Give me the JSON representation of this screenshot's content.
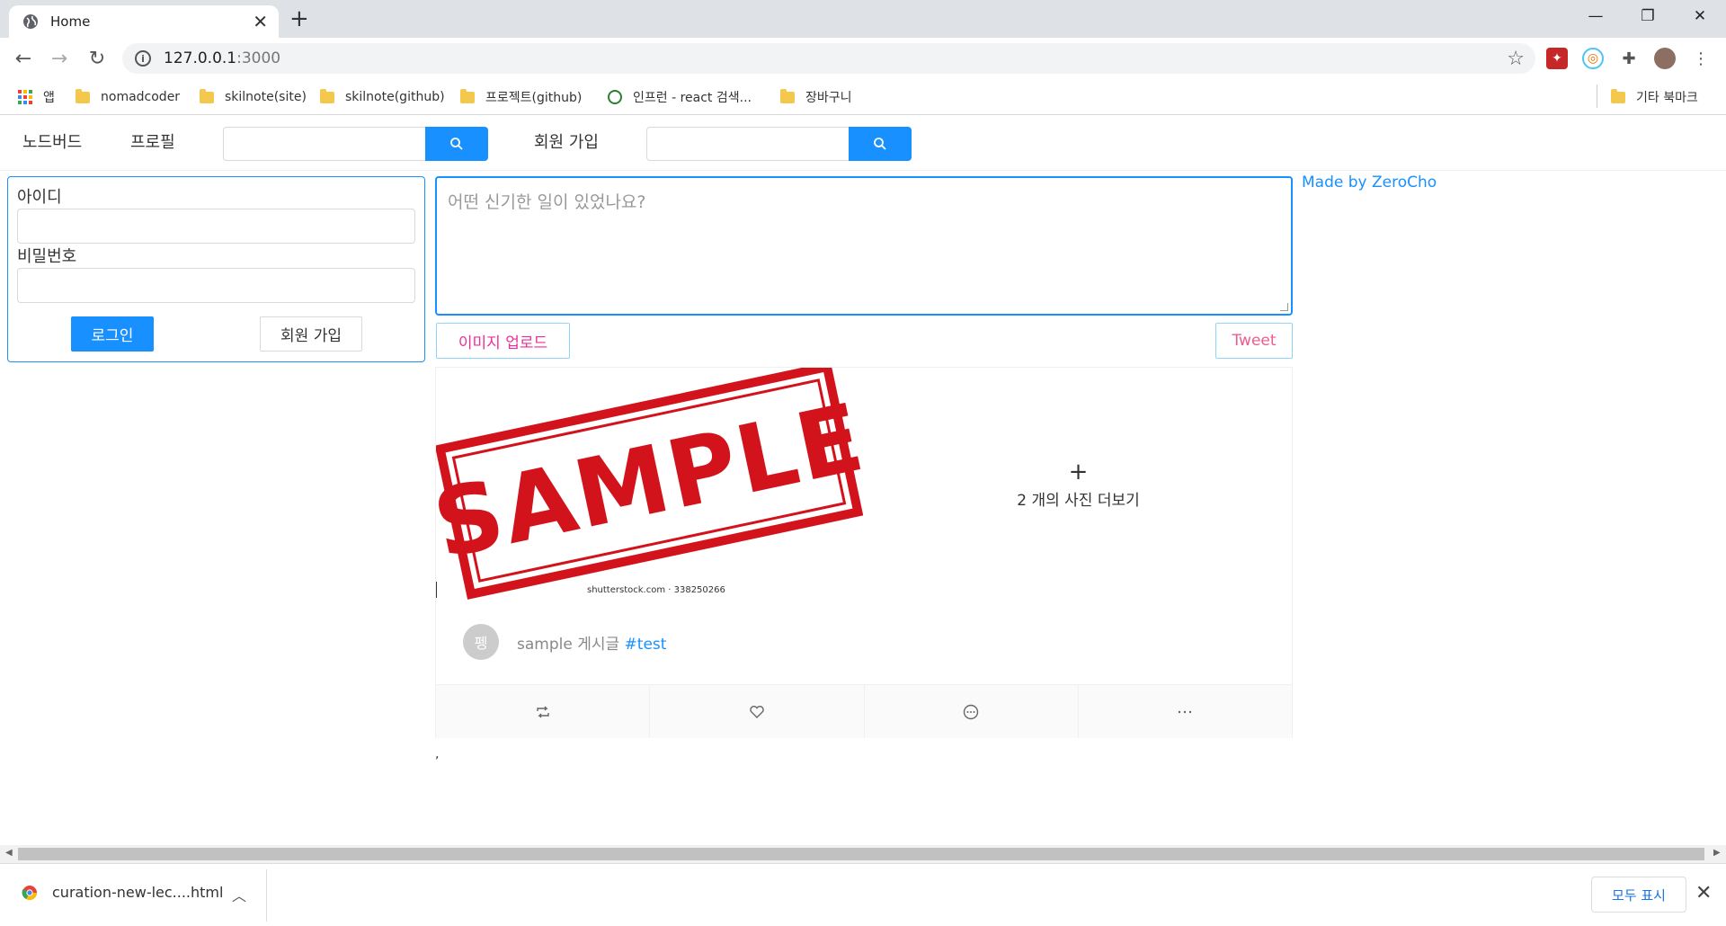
{
  "browser": {
    "tab_title": "Home",
    "url_host": "127.0.0.1",
    "url_port": ":3000",
    "bookmarks": [
      {
        "label": "앱",
        "icon": "apps-grid-icon"
      },
      {
        "label": "nomadcoder",
        "icon": "folder-icon"
      },
      {
        "label": "skilnote(site)",
        "icon": "folder-icon"
      },
      {
        "label": "skilnote(github)",
        "icon": "folder-icon"
      },
      {
        "label": "프로젝트(github)",
        "icon": "folder-icon"
      },
      {
        "label": "인프런 - react 검색...",
        "icon": "inflearn-icon"
      },
      {
        "label": "장바구니",
        "icon": "folder-icon"
      }
    ],
    "other_bookmarks": "기타 북마크"
  },
  "menu": {
    "items": [
      "노드버드",
      "프로필",
      "회원 가입"
    ]
  },
  "login": {
    "id_label": "아이디",
    "password_label": "비밀번호",
    "login_button": "로그인",
    "signup_button": "회원 가입"
  },
  "post_form": {
    "placeholder": "어떤 신기한 일이 있었나요?",
    "upload_button": "이미지 업로드",
    "tweet_button": "Tweet"
  },
  "madeby": "Made by ZeroCho",
  "post": {
    "stamp_text": "SAMPLE",
    "watermark": "shutterstock.com · 338250266",
    "more_photos": "2 개의 사진 더보기",
    "avatar_initial": "펭",
    "content_text": "sample 게시글 ",
    "hashtag": "#test",
    "trailing": ","
  },
  "downloads": {
    "file_name": "curation-new-lec....html",
    "show_all": "모두 표시"
  },
  "colors": {
    "primary": "#1890ff",
    "stamp_red": "#d3131c",
    "pink": "#eb2f96"
  }
}
